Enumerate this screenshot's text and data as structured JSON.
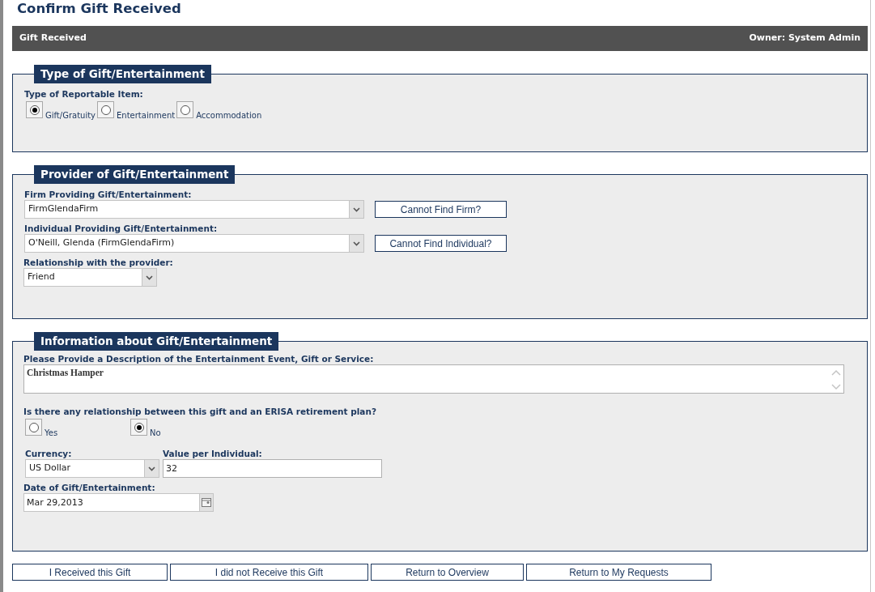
{
  "page_title": "Confirm Gift Received",
  "header_bar": {
    "title": "Gift Received",
    "owner": "Owner: System Admin"
  },
  "sections": [
    {
      "legend": "Type of Gift/Entertainment",
      "fields": [
        {
          "kind": "radio_group",
          "label": "Type of Reportable Item:",
          "options": [
            {
              "label": "Gift/Gratuity",
              "selected": true
            },
            {
              "label": "Entertainment",
              "selected": false
            },
            {
              "label": "Accommodation",
              "selected": false
            }
          ]
        }
      ]
    },
    {
      "legend": "Provider of Gift/Entertainment",
      "fields": [
        {
          "kind": "select_with_button",
          "label": "Firm Providing Gift/Entertainment:",
          "value": "FirmGlendaFirm",
          "button": "Cannot Find Firm?"
        },
        {
          "kind": "select_with_button",
          "label": "Individual Providing Gift/Entertainment:",
          "value": "O'Neill, Glenda (FirmGlendaFirm)",
          "button": "Cannot Find Individual?"
        },
        {
          "kind": "select",
          "label": "Relationship with the provider:",
          "value": "Friend"
        }
      ]
    },
    {
      "legend": "Information about Gift/Entertainment",
      "fields": [
        {
          "kind": "textarea",
          "label": "Please Provide a Description of the Entertainment Event, Gift or Service:",
          "value": "Christmas Hamper"
        },
        {
          "kind": "yes_no",
          "label": "Is there any relationship between this gift and an ERISA retirement plan?",
          "options": [
            {
              "label": "Yes",
              "selected": false
            },
            {
              "label": "No",
              "selected": true
            }
          ]
        },
        {
          "kind": "currency_value",
          "label": "Currency:",
          "value": "US Dollar",
          "label_2": "Value per Individual:",
          "value_2": "32"
        },
        {
          "kind": "date",
          "label": "Date of Gift/Entertainment:",
          "value": "Mar 29,2013"
        }
      ]
    }
  ],
  "buttons": [
    "I Received this Gift",
    "I did not Receive this Gift",
    "Return to Overview",
    "Return to My Requests"
  ]
}
